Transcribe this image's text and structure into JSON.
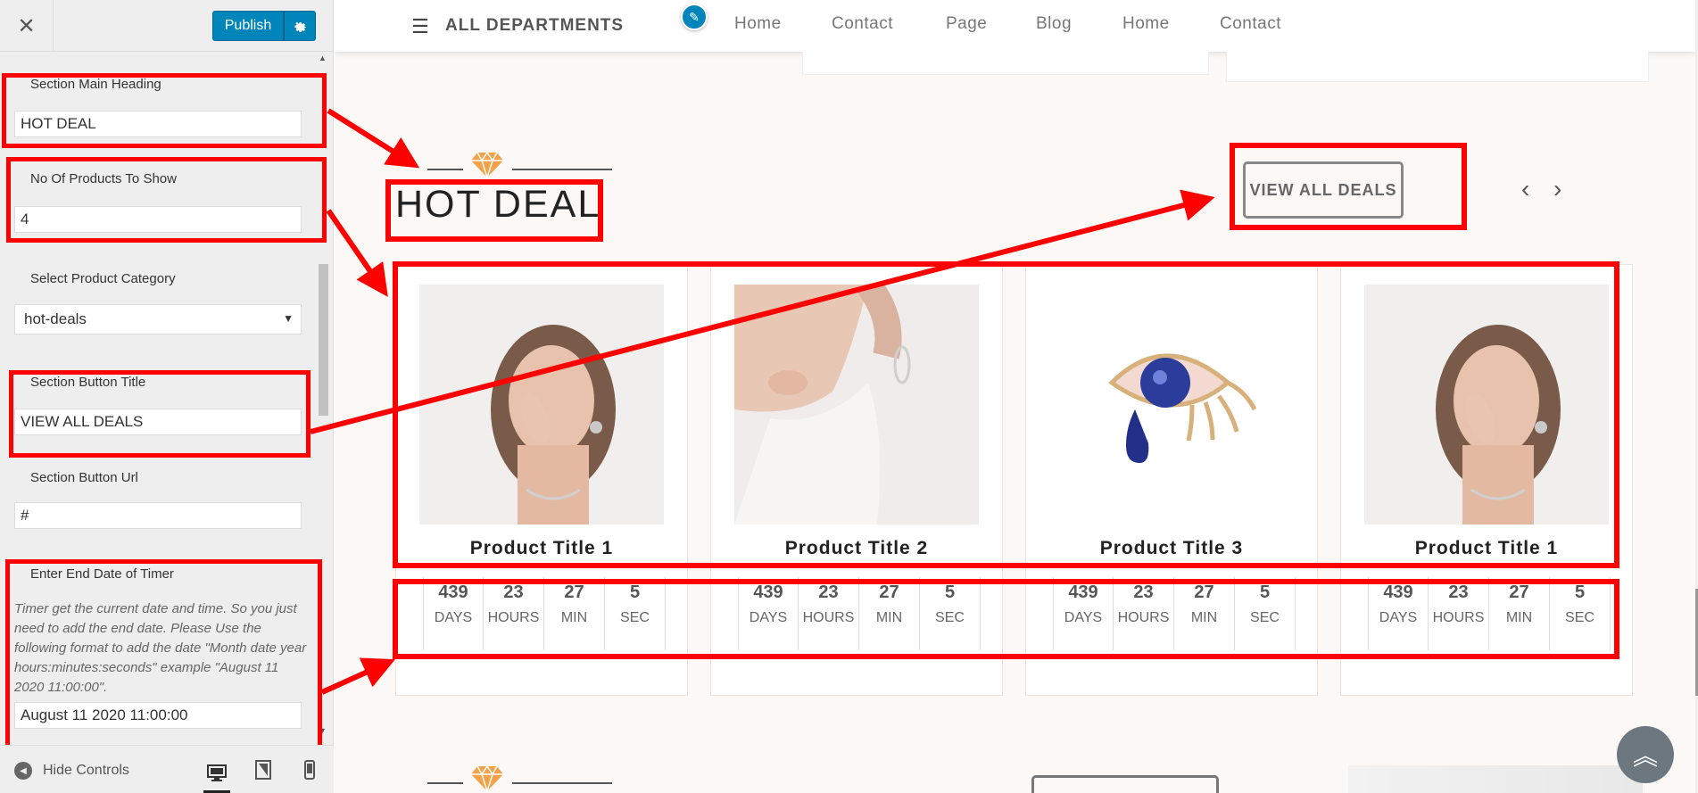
{
  "sidebar": {
    "close_glyph": "✕",
    "publish_label": "Publish",
    "fields": {
      "main_heading_label": "Section Main Heading",
      "main_heading_value": "HOT DEAL",
      "num_products_label": "No Of Products To Show",
      "num_products_value": "4",
      "category_label": "Select Product Category",
      "category_value": "hot-deals",
      "button_title_label": "Section Button Title",
      "button_title_value": "VIEW ALL DEALS",
      "button_url_label": "Section Button Url",
      "button_url_value": "#",
      "timer_label": "Enter End Date of Timer",
      "timer_description": "Timer get the current date and time. So you just need to add the end date. Please Use the following format to add the date \"Month date year hours:minutes:seconds\" example \"August 11 2020 11:00:00\".",
      "timer_value": "August 11 2020 11:00:00"
    },
    "footer": {
      "hide_controls": "Hide Controls"
    }
  },
  "header": {
    "departments": "ALL DEPARTMENTS",
    "nav": [
      "Home",
      "Contact",
      "Page",
      "Blog",
      "Home",
      "Contact"
    ]
  },
  "section": {
    "title": "HOT DEAL",
    "view_all": "VIEW ALL DEALS"
  },
  "products": [
    {
      "title": "Product Title 1",
      "image": "woman-earring-photo",
      "timer": {
        "days": "439",
        "hours": "23",
        "min": "27",
        "sec": "5"
      }
    },
    {
      "title": "Product Title 2",
      "image": "woman-neck-earring-photo",
      "timer": {
        "days": "439",
        "hours": "23",
        "min": "27",
        "sec": "5"
      }
    },
    {
      "title": "Product Title 3",
      "image": "eye-brooch-photo",
      "timer": {
        "days": "439",
        "hours": "23",
        "min": "27",
        "sec": "5"
      }
    },
    {
      "title": "Product Title 1",
      "image": "woman-earring-photo",
      "timer": {
        "days": "439",
        "hours": "23",
        "min": "27",
        "sec": "5"
      }
    }
  ],
  "timer_units": {
    "days": "DAYS",
    "hours": "HOURS",
    "min": "MIN",
    "sec": "SEC"
  },
  "colors": {
    "accent": "#0085ba",
    "annotation": "#ff0000",
    "gem": "#f4a24a"
  }
}
